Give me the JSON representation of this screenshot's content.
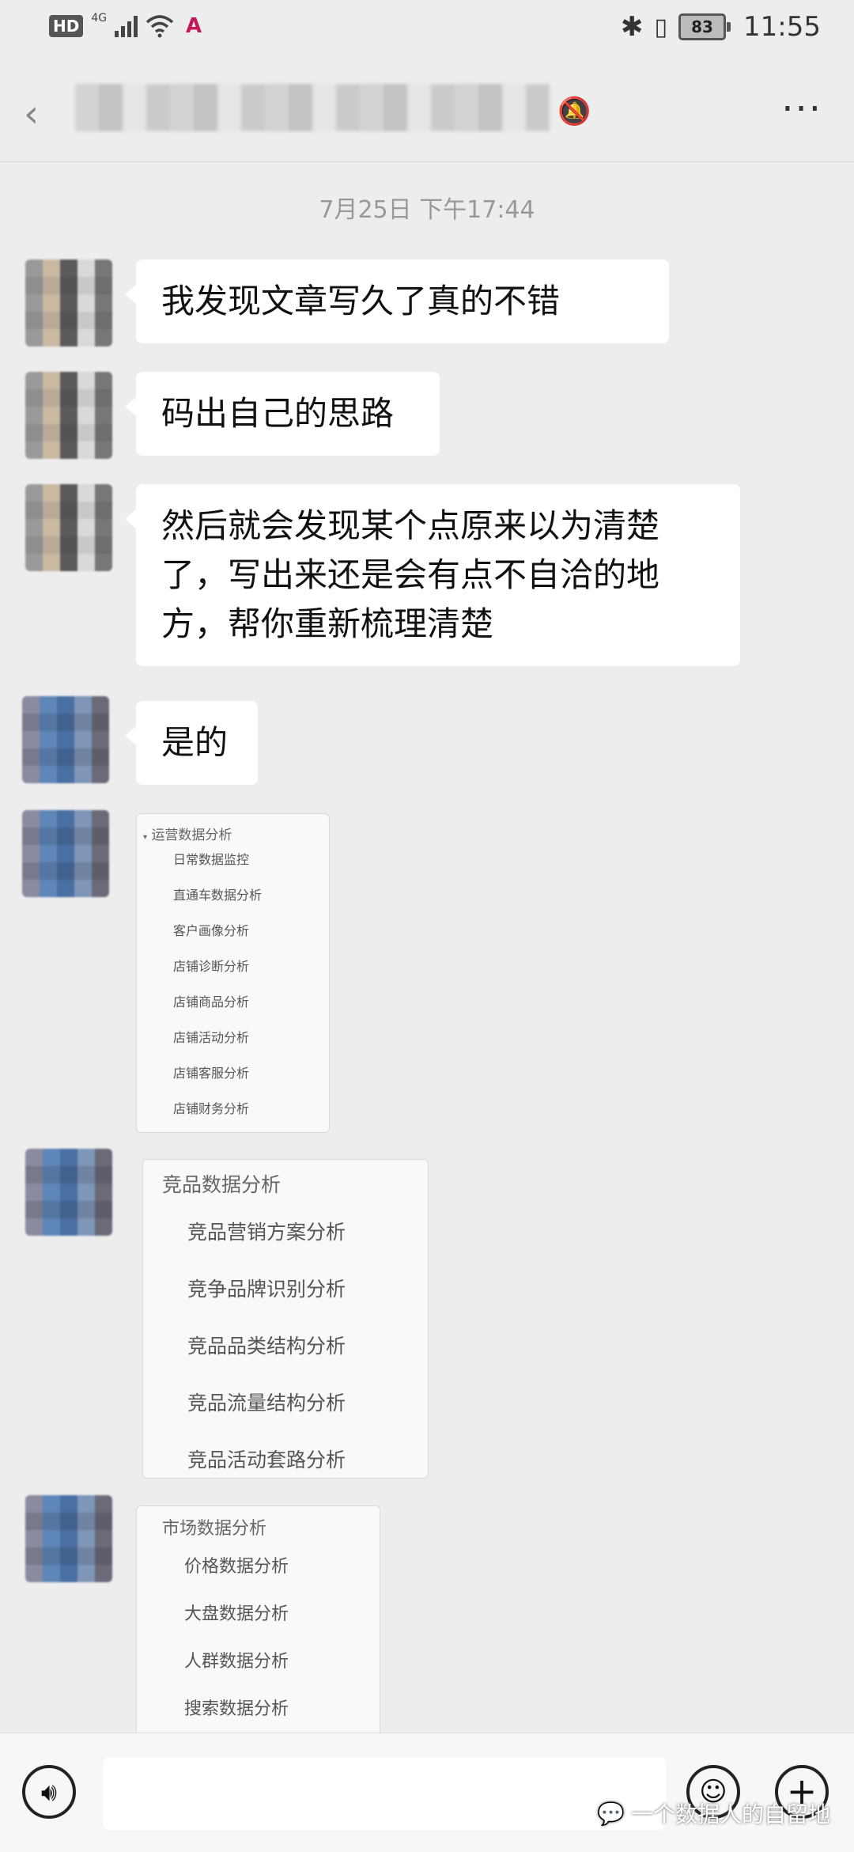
{
  "status_bar": {
    "hd": "HD",
    "network": "4G",
    "battery": "83",
    "time": "11:55"
  },
  "nav": {
    "more_icon": "more-icon"
  },
  "timestamp": "7月25日 下午17:44",
  "messages": [
    {
      "text": "我发现文章写久了真的不错"
    },
    {
      "text": "码出自己的思路"
    },
    {
      "text": "然后就会发现某个点原来以为清楚了，写出来还是会有点不自洽的地方，帮你重新梳理清楚"
    },
    {
      "text": "是的"
    }
  ],
  "image_cards": [
    {
      "title": "运营数据分析",
      "items": [
        "日常数据监控",
        "直通车数据分析",
        "客户画像分析",
        "店铺诊断分析",
        "店铺商品分析",
        "店铺活动分析",
        "店铺客服分析",
        "店铺财务分析"
      ]
    },
    {
      "title": "竞品数据分析",
      "items": [
        "竞品营销方案分析",
        "竞争品牌识别分析",
        "竞品品类结构分析",
        "竞品流量结构分析",
        "竞品活动套路分析"
      ]
    },
    {
      "title": "市场数据分析",
      "items": [
        "价格数据分析",
        "大盘数据分析",
        "人群数据分析",
        "搜索数据分析"
      ]
    }
  ],
  "watermark": "一个数据人的自留地"
}
